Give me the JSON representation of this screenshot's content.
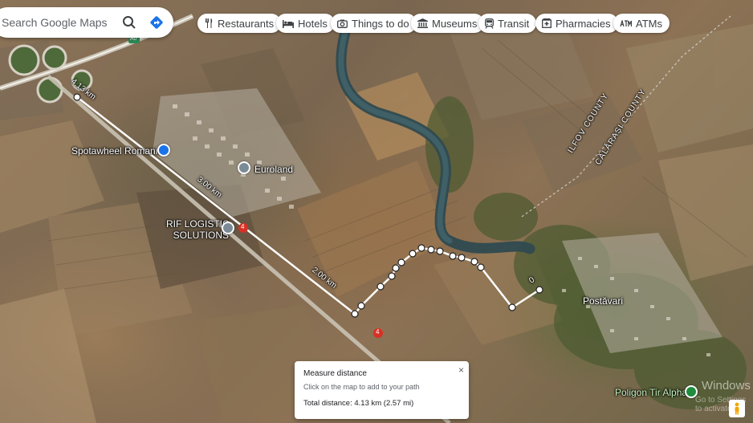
{
  "search": {
    "placeholder": "Search Google Maps"
  },
  "chips": [
    {
      "label": "Restaurants",
      "icon": "fork-knife-icon"
    },
    {
      "label": "Hotels",
      "icon": "bed-icon"
    },
    {
      "label": "Things to do",
      "icon": "camera-icon"
    },
    {
      "label": "Museums",
      "icon": "museum-icon"
    },
    {
      "label": "Transit",
      "icon": "train-icon"
    },
    {
      "label": "Pharmacies",
      "icon": "pharmacy-icon"
    },
    {
      "label": "ATMs",
      "icon": "atm-icon"
    }
  ],
  "places": {
    "spotawheel": "Spotawheel Romania",
    "euroland": "Euroland",
    "rif_line1": "RIF LOGISTIC",
    "rif_line2": "SOLUTIONS",
    "postavari": "Postăvari",
    "poligon": "Poligon Tir Alpha",
    "county_ilfov": "ILFOV COUNTY",
    "county_calarasi": "CĂLĂRAȘI COUNTY"
  },
  "route_labels": {
    "dist_413": "4.13 km",
    "dist_300": "3.00 km",
    "dist_200": "2.00 km",
    "dist_0": "0",
    "road_a0": "A0",
    "road_4a": "4",
    "road_4b": "4"
  },
  "measure_panel": {
    "title": "Measure distance",
    "subtitle": "Click on the map to add to your path",
    "total": "Total distance: 4.13 km (2.57 mi)",
    "close": "×"
  },
  "overlay": {
    "watermark": "Windows",
    "watermark_sub": "Go to Settings to activate"
  },
  "colors": {
    "route": "#ffffff",
    "river": "#3b5a60",
    "chip_text": "#3c4043",
    "pin_blue": "#1a73e8",
    "pin_green": "#1e8e3e"
  }
}
